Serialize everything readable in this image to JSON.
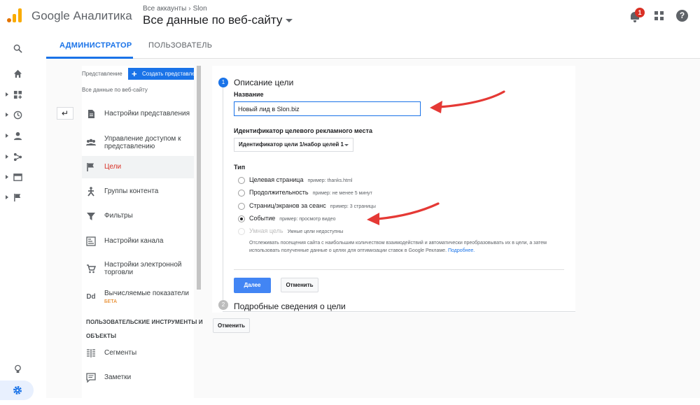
{
  "header": {
    "app_name": "Google Аналитика",
    "breadcrumb": [
      "Все аккаунты",
      "Slon"
    ],
    "view_title": "Все данные по веб-сайту",
    "notification_count": "1",
    "help_glyph": "?"
  },
  "tabs": {
    "admin": "АДМИНИСТРАТОР",
    "user": "ПОЛЬЗОВАТЕЛЬ"
  },
  "view_column": {
    "label": "Представление",
    "create_button": "Создать представление",
    "view_name": "Все данные по веб-сайту",
    "items": [
      {
        "label": "Настройки представления",
        "icon": "document-icon"
      },
      {
        "label": "Управление доступом к представлению",
        "icon": "people-icon"
      },
      {
        "label": "Цели",
        "icon": "flag-icon"
      },
      {
        "label": "Группы контента",
        "icon": "person-figure-icon"
      },
      {
        "label": "Фильтры",
        "icon": "filter-icon"
      },
      {
        "label": "Настройки канала",
        "icon": "channel-icon"
      },
      {
        "label": "Настройки электронной торговли",
        "icon": "cart-icon"
      },
      {
        "label": "Вычисляемые показатели",
        "icon": "dd-icon",
        "badge": "БЕТА"
      }
    ],
    "section_header": [
      "ПОЛЬЗОВАТЕЛЬСКИЕ ИНСТРУМЕНТЫ И",
      "ОБЪЕКТЫ"
    ],
    "tools": [
      {
        "label": "Сегменты",
        "icon": "segments-icon"
      },
      {
        "label": "Заметки",
        "icon": "notes-icon"
      }
    ]
  },
  "goal": {
    "step1": {
      "number": "1",
      "title": "Описание цели"
    },
    "name_label": "Название",
    "name_value": "Новый лид в Slon.biz",
    "slot_label": "Идентификатор целевого рекламного места",
    "slot_value": "Идентификатор цели 1/набор целей 1",
    "type_label": "Тип",
    "types": [
      {
        "label": "Целевая страница",
        "example": "пример: thanks.html",
        "selected": false,
        "disabled": false
      },
      {
        "label": "Продолжительность",
        "example": "пример: не менее 5 минут",
        "selected": false,
        "disabled": false
      },
      {
        "label": "Страниц/экранов за сеанс",
        "example": "пример: 3 страницы",
        "selected": false,
        "disabled": false
      },
      {
        "label": "Событие",
        "example": "пример: просмотр видео",
        "selected": true,
        "disabled": false
      },
      {
        "label": "Умная цель",
        "example": "Умные цели недоступны",
        "selected": false,
        "disabled": true
      }
    ],
    "smart_desc": "Отслеживать посещения сайта с наибольшим количеством взаимодействий и автоматически преобразовывать их в цели, а затем использовать полученные данные о целях для оптимизации ставок в Google Рекламе.",
    "smart_link": "Подробнее.",
    "continue_button": "Далее",
    "cancel_button": "Отменить",
    "step2": {
      "number": "2",
      "title": "Подробные сведения о цели"
    },
    "cancel_bottom": "Отменить"
  },
  "colors": {
    "accent": "#1a73e8",
    "active_nav": "#d93025",
    "annotation_arrow": "#e53935"
  }
}
